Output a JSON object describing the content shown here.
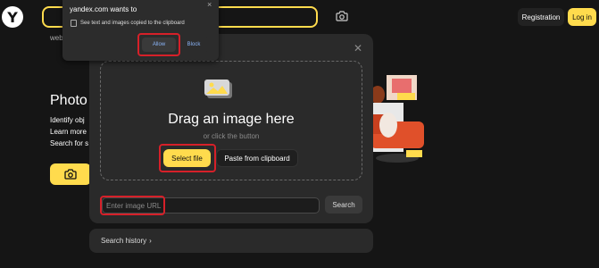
{
  "header": {
    "logo_letter": "Y",
    "registration_label": "Registration",
    "login_label": "Log in",
    "tab_web_label": "web",
    "camera_icon": "camera-icon"
  },
  "hero": {
    "title": "Photo",
    "lines": [
      "Identify obj",
      "Learn more",
      "Search for s"
    ],
    "button_icon": "camera-icon"
  },
  "dialog": {
    "close_icon": "close-icon",
    "image_icon": "image-icon",
    "drop_title": "Drag an image here",
    "drop_sub": "or click the button",
    "select_file_label": "Select file",
    "paste_label": "Paste from clipboard",
    "url_placeholder": "Enter image URL",
    "search_label": "Search",
    "history_label": "Search history",
    "history_chevron": "›"
  },
  "permission_popup": {
    "title": "yandex.com wants to",
    "message": "See text and images copied to the clipboard",
    "allow_label": "Allow",
    "block_label": "Block",
    "close_symbol": "×"
  },
  "colors": {
    "accent": "#ffdb4d",
    "highlight": "#d62029",
    "background": "#151515",
    "dialog": "#2a2a2a",
    "link": "#8ab4f8"
  }
}
